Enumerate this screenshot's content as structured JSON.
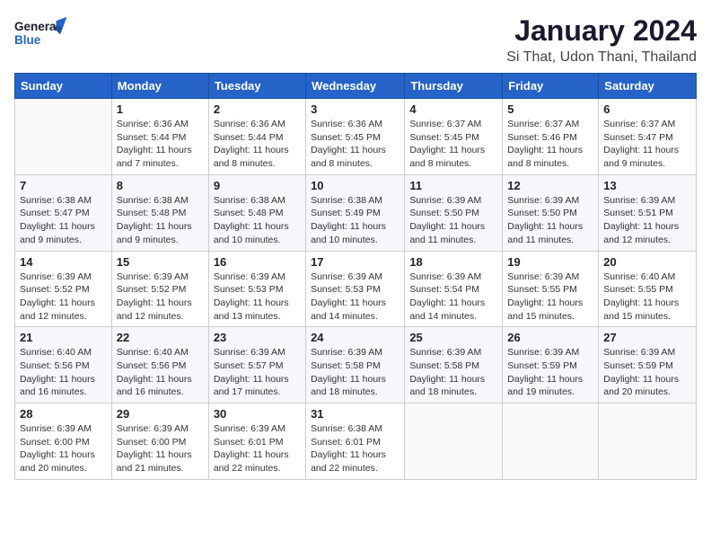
{
  "header": {
    "logo_line1": "General",
    "logo_line2": "Blue",
    "title": "January 2024",
    "subtitle": "Si That, Udon Thani, Thailand"
  },
  "days_of_week": [
    "Sunday",
    "Monday",
    "Tuesday",
    "Wednesday",
    "Thursday",
    "Friday",
    "Saturday"
  ],
  "weeks": [
    [
      {
        "day": "",
        "info": ""
      },
      {
        "day": "1",
        "info": "Sunrise: 6:36 AM\nSunset: 5:44 PM\nDaylight: 11 hours\nand 7 minutes."
      },
      {
        "day": "2",
        "info": "Sunrise: 6:36 AM\nSunset: 5:44 PM\nDaylight: 11 hours\nand 8 minutes."
      },
      {
        "day": "3",
        "info": "Sunrise: 6:36 AM\nSunset: 5:45 PM\nDaylight: 11 hours\nand 8 minutes."
      },
      {
        "day": "4",
        "info": "Sunrise: 6:37 AM\nSunset: 5:45 PM\nDaylight: 11 hours\nand 8 minutes."
      },
      {
        "day": "5",
        "info": "Sunrise: 6:37 AM\nSunset: 5:46 PM\nDaylight: 11 hours\nand 8 minutes."
      },
      {
        "day": "6",
        "info": "Sunrise: 6:37 AM\nSunset: 5:47 PM\nDaylight: 11 hours\nand 9 minutes."
      }
    ],
    [
      {
        "day": "7",
        "info": "Sunrise: 6:38 AM\nSunset: 5:47 PM\nDaylight: 11 hours\nand 9 minutes."
      },
      {
        "day": "8",
        "info": "Sunrise: 6:38 AM\nSunset: 5:48 PM\nDaylight: 11 hours\nand 9 minutes."
      },
      {
        "day": "9",
        "info": "Sunrise: 6:38 AM\nSunset: 5:48 PM\nDaylight: 11 hours\nand 10 minutes."
      },
      {
        "day": "10",
        "info": "Sunrise: 6:38 AM\nSunset: 5:49 PM\nDaylight: 11 hours\nand 10 minutes."
      },
      {
        "day": "11",
        "info": "Sunrise: 6:39 AM\nSunset: 5:50 PM\nDaylight: 11 hours\nand 11 minutes."
      },
      {
        "day": "12",
        "info": "Sunrise: 6:39 AM\nSunset: 5:50 PM\nDaylight: 11 hours\nand 11 minutes."
      },
      {
        "day": "13",
        "info": "Sunrise: 6:39 AM\nSunset: 5:51 PM\nDaylight: 11 hours\nand 12 minutes."
      }
    ],
    [
      {
        "day": "14",
        "info": "Sunrise: 6:39 AM\nSunset: 5:52 PM\nDaylight: 11 hours\nand 12 minutes."
      },
      {
        "day": "15",
        "info": "Sunrise: 6:39 AM\nSunset: 5:52 PM\nDaylight: 11 hours\nand 12 minutes."
      },
      {
        "day": "16",
        "info": "Sunrise: 6:39 AM\nSunset: 5:53 PM\nDaylight: 11 hours\nand 13 minutes."
      },
      {
        "day": "17",
        "info": "Sunrise: 6:39 AM\nSunset: 5:53 PM\nDaylight: 11 hours\nand 14 minutes."
      },
      {
        "day": "18",
        "info": "Sunrise: 6:39 AM\nSunset: 5:54 PM\nDaylight: 11 hours\nand 14 minutes."
      },
      {
        "day": "19",
        "info": "Sunrise: 6:39 AM\nSunset: 5:55 PM\nDaylight: 11 hours\nand 15 minutes."
      },
      {
        "day": "20",
        "info": "Sunrise: 6:40 AM\nSunset: 5:55 PM\nDaylight: 11 hours\nand 15 minutes."
      }
    ],
    [
      {
        "day": "21",
        "info": "Sunrise: 6:40 AM\nSunset: 5:56 PM\nDaylight: 11 hours\nand 16 minutes."
      },
      {
        "day": "22",
        "info": "Sunrise: 6:40 AM\nSunset: 5:56 PM\nDaylight: 11 hours\nand 16 minutes."
      },
      {
        "day": "23",
        "info": "Sunrise: 6:39 AM\nSunset: 5:57 PM\nDaylight: 11 hours\nand 17 minutes."
      },
      {
        "day": "24",
        "info": "Sunrise: 6:39 AM\nSunset: 5:58 PM\nDaylight: 11 hours\nand 18 minutes."
      },
      {
        "day": "25",
        "info": "Sunrise: 6:39 AM\nSunset: 5:58 PM\nDaylight: 11 hours\nand 18 minutes."
      },
      {
        "day": "26",
        "info": "Sunrise: 6:39 AM\nSunset: 5:59 PM\nDaylight: 11 hours\nand 19 minutes."
      },
      {
        "day": "27",
        "info": "Sunrise: 6:39 AM\nSunset: 5:59 PM\nDaylight: 11 hours\nand 20 minutes."
      }
    ],
    [
      {
        "day": "28",
        "info": "Sunrise: 6:39 AM\nSunset: 6:00 PM\nDaylight: 11 hours\nand 20 minutes."
      },
      {
        "day": "29",
        "info": "Sunrise: 6:39 AM\nSunset: 6:00 PM\nDaylight: 11 hours\nand 21 minutes."
      },
      {
        "day": "30",
        "info": "Sunrise: 6:39 AM\nSunset: 6:01 PM\nDaylight: 11 hours\nand 22 minutes."
      },
      {
        "day": "31",
        "info": "Sunrise: 6:38 AM\nSunset: 6:01 PM\nDaylight: 11 hours\nand 22 minutes."
      },
      {
        "day": "",
        "info": ""
      },
      {
        "day": "",
        "info": ""
      },
      {
        "day": "",
        "info": ""
      }
    ]
  ]
}
